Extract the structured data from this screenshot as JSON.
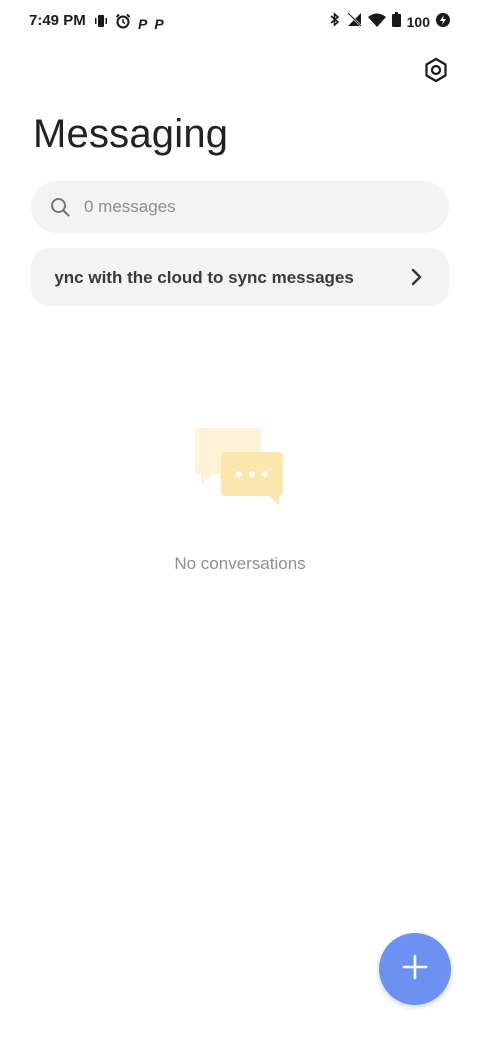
{
  "status_bar": {
    "time": "7:49 PM",
    "left_icons": [
      "vibrate-icon",
      "alarm-icon",
      "p-notification-icon",
      "p-notification-icon"
    ],
    "p_glyph": "P",
    "right_icons": [
      "bluetooth-icon",
      "no-signal-icon",
      "wifi-icon",
      "battery-icon",
      "charging-icon"
    ],
    "battery_level": "100"
  },
  "header": {
    "title": "Messaging",
    "settings_icon": "settings-icon"
  },
  "search": {
    "placeholder": "0 messages",
    "icon": "search-icon"
  },
  "sync_banner": {
    "text": "Sync with the cloud to sync messages",
    "chevron_icon": "chevron-right-icon"
  },
  "empty_state": {
    "illustration": "chat-bubbles-icon",
    "message": "No conversations"
  },
  "fab": {
    "icon": "plus-icon",
    "color": "#6b92f2"
  },
  "colors": {
    "background": "#ffffff",
    "card": "#f3f3f3",
    "accent": "#6b92f2",
    "illustration": "#fde9b6"
  }
}
